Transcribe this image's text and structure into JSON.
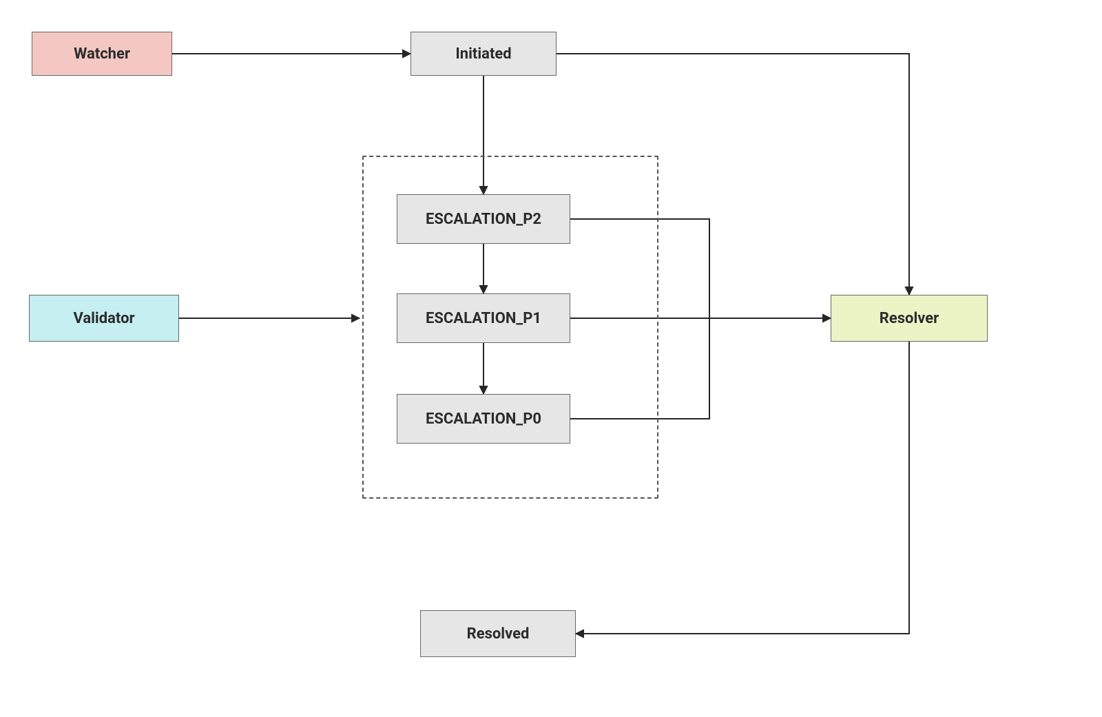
{
  "nodes": {
    "watcher": {
      "label": "Watcher"
    },
    "initiated": {
      "label": "Initiated"
    },
    "validator": {
      "label": "Validator"
    },
    "escalation_p2": {
      "label": "ESCALATION_P2"
    },
    "escalation_p1": {
      "label": "ESCALATION_P1"
    },
    "escalation_p0": {
      "label": "ESCALATION_P0"
    },
    "resolver": {
      "label": "Resolver"
    },
    "resolved": {
      "label": "Resolved"
    }
  },
  "colors": {
    "grey": "#e6e6e6",
    "pink": "#f4c7c2",
    "cyan": "#c5eff1",
    "yellow": "#ecf4c6",
    "border": "#676767",
    "arrow": "#262626"
  },
  "edges": [
    {
      "from": "watcher",
      "to": "initiated"
    },
    {
      "from": "initiated",
      "to": "escalation_p2"
    },
    {
      "from": "initiated",
      "to": "resolver"
    },
    {
      "from": "validator",
      "to": "group"
    },
    {
      "from": "escalation_p2",
      "to": "escalation_p1"
    },
    {
      "from": "escalation_p1",
      "to": "escalation_p0"
    },
    {
      "from": "escalation_p2",
      "to": "resolver"
    },
    {
      "from": "escalation_p1",
      "to": "resolver"
    },
    {
      "from": "escalation_p0",
      "to": "resolver"
    },
    {
      "from": "resolver",
      "to": "resolved"
    }
  ]
}
